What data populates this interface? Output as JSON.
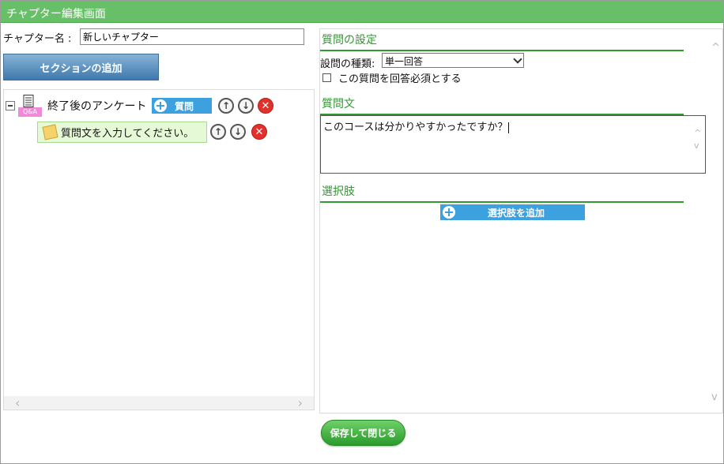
{
  "window": {
    "title": "チャプター編集画面"
  },
  "chapter": {
    "name_label": "チャプター名 :",
    "name_value": "新しいチャプター"
  },
  "left": {
    "add_section_label": "セクションの追加"
  },
  "tree": {
    "section": {
      "title": "終了後のアンケート",
      "qa_tag": "Q&A",
      "question_button_label": "質問"
    },
    "question_node": {
      "label": "質問文を入力してください。"
    },
    "scroll_left": "‹",
    "scroll_right": "›"
  },
  "settings": {
    "heading": "質問の設定",
    "type_label": "設問の種類:",
    "type_value": "単一回答",
    "required_label": "この質問を回答必須とする"
  },
  "question_text": {
    "heading": "質問文",
    "value": "このコースは分かりやすかったですか？"
  },
  "choices": {
    "heading": "選択肢",
    "add_label": "選択肢を追加"
  },
  "footer": {
    "save_label": "保存して閉じる"
  },
  "icons": {
    "up": "↑",
    "down": "↓",
    "delete": "✕",
    "scroll_up": "^",
    "scroll_down": "v"
  },
  "colors": {
    "titlebar": "#67bf67",
    "accent_green": "#2f9a2f",
    "blue_button": "#3da0df",
    "delete_red": "#e2312a"
  }
}
